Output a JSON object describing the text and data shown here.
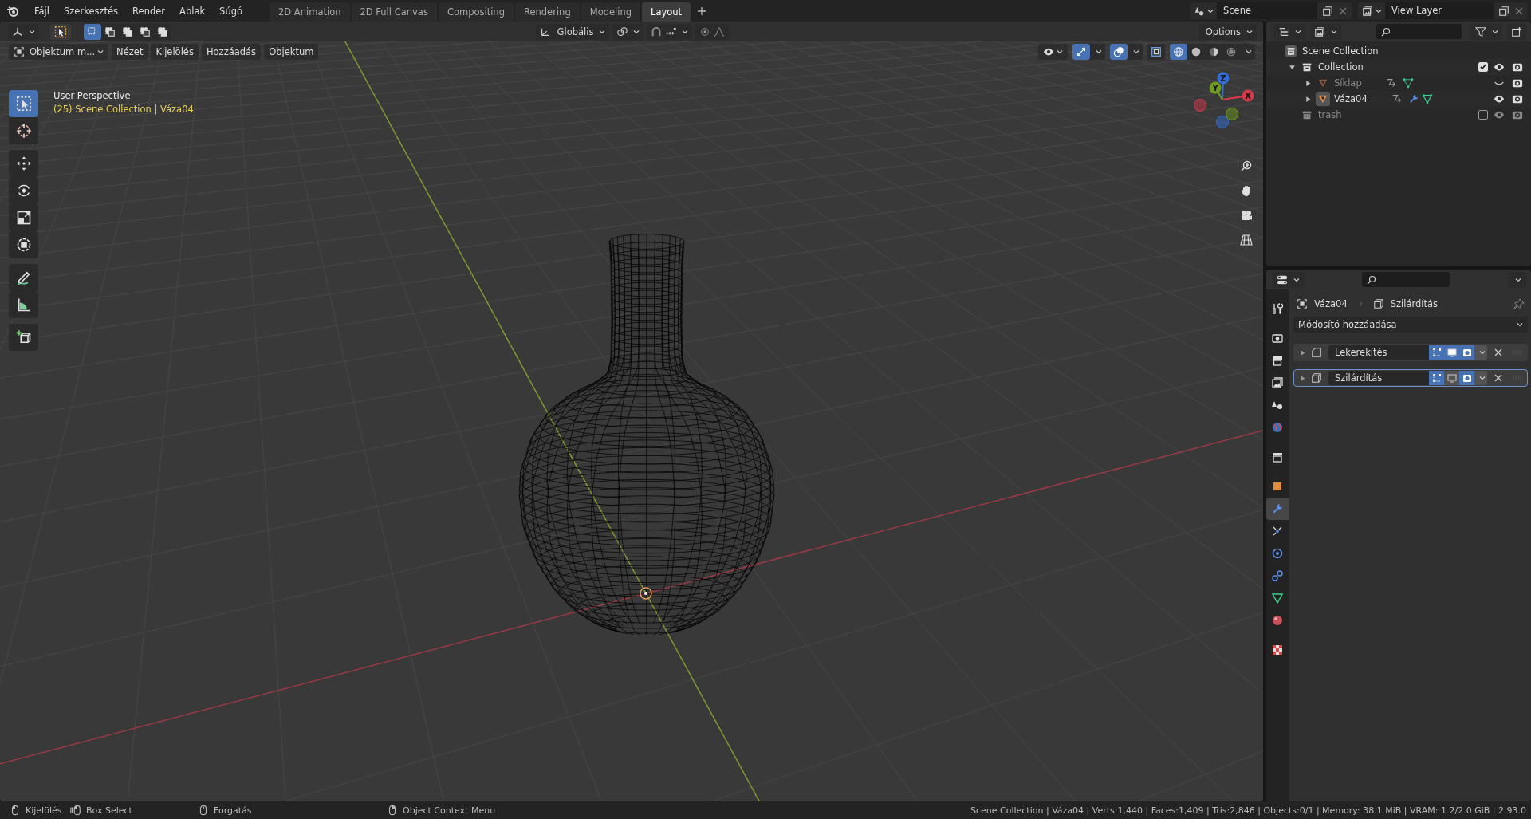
{
  "top_bar": {
    "menus": [
      "Fájl",
      "Szerkesztés",
      "Render",
      "Ablak",
      "Súgó"
    ],
    "workspaces": [
      {
        "label": "2D Animation",
        "selected": false
      },
      {
        "label": "2D Full Canvas",
        "selected": false
      },
      {
        "label": "Compositing",
        "selected": false
      },
      {
        "label": "Rendering",
        "selected": false
      },
      {
        "label": "Modeling",
        "selected": false
      },
      {
        "label": "Layout",
        "selected": true
      }
    ],
    "scene": "Scene",
    "view_layer": "View Layer"
  },
  "viewport": {
    "select_modes": [
      {
        "selected": true
      },
      {
        "selected": false
      },
      {
        "selected": false
      },
      {
        "selected": false
      },
      {
        "selected": false
      }
    ],
    "orientation": "Globális",
    "options": "Options",
    "mode": "Objektum m...",
    "menus": [
      "Nézet",
      "Kijelölés",
      "Hozzáadás",
      "Objektum"
    ],
    "shading": [
      {
        "kind": "wireframe",
        "selected": true
      },
      {
        "kind": "solid",
        "selected": false
      },
      {
        "kind": "material",
        "selected": false
      },
      {
        "kind": "rendered",
        "selected": false
      }
    ],
    "perspective": "User Perspective",
    "object_info": "(25) Scene Collection | Váza04",
    "tools": [
      {
        "kind": "select_box",
        "selected": true
      },
      {
        "kind": "cursor",
        "selected": false
      },
      {
        "kind": "move",
        "selected": false
      },
      {
        "kind": "rotate",
        "selected": false
      },
      {
        "kind": "scale",
        "selected": false
      },
      {
        "kind": "transform",
        "selected": false
      },
      {
        "kind": "annotate",
        "selected": false
      },
      {
        "kind": "measure",
        "selected": false
      },
      {
        "kind": "add_cube",
        "selected": false
      }
    ],
    "gizmo_axes": [
      {
        "label": "Z",
        "color": "#2f6fd6"
      },
      {
        "label": "Y",
        "color": "#6f9c1c"
      },
      {
        "label": "X",
        "color": "#d9384b"
      }
    ]
  },
  "outliner": {
    "tree": [
      {
        "name": "Scene Collection",
        "kind": "scene",
        "selected": false,
        "children": [
          {
            "name": "Collection",
            "kind": "collection",
            "selected": false,
            "expanded": true,
            "checked": true,
            "visible": true,
            "children": [
              {
                "name": "Síklap",
                "kind": "mesh",
                "selected": false,
                "expanded": false,
                "visible": false,
                "modifiers": false
              },
              {
                "name": "Váza04",
                "kind": "mesh",
                "selected": true,
                "expanded": false,
                "visible": true,
                "modifiers": true
              }
            ]
          },
          {
            "name": "trash",
            "kind": "collection",
            "selected": false,
            "checked": false,
            "visible": true
          }
        ]
      }
    ]
  },
  "properties": {
    "object": "Váza04",
    "modifier": "Szilárdítás",
    "add_modifier": "Módosító hozzáadása",
    "tabs": [
      {
        "kind": "tool",
        "selected": false
      },
      {
        "kind": "render",
        "selected": false
      },
      {
        "kind": "output",
        "selected": false
      },
      {
        "kind": "view_layer",
        "selected": false
      },
      {
        "kind": "scene",
        "selected": false
      },
      {
        "kind": "world",
        "selected": false
      },
      {
        "kind": "collection",
        "selected": false
      },
      {
        "kind": "object",
        "selected": false
      },
      {
        "kind": "modifiers",
        "selected": true
      },
      {
        "kind": "particles",
        "selected": false
      },
      {
        "kind": "physics",
        "selected": false
      },
      {
        "kind": "constraints",
        "selected": false
      },
      {
        "kind": "data",
        "selected": false
      },
      {
        "kind": "material",
        "selected": false
      },
      {
        "kind": "texture",
        "selected": false
      }
    ],
    "modifiers": [
      {
        "name": "Lekerekítés",
        "kind": "bevel",
        "expanded": false,
        "selected": false,
        "edit_mode": true,
        "viewport": true,
        "render": true
      },
      {
        "name": "Szilárdítás",
        "kind": "solidify",
        "expanded": false,
        "selected": true,
        "edit_mode": true,
        "viewport": false,
        "render": true
      }
    ]
  },
  "status_bar": {
    "hints": [
      {
        "kind": "mouse_left",
        "label": "Kijelölés"
      },
      {
        "kind": "mouse_drag",
        "label": "Box Select"
      },
      {
        "kind": "mouse_middle",
        "label": "Forgatás"
      },
      {
        "kind": "mouse_right",
        "label": "Object Context Menu"
      }
    ],
    "stats": "Scene Collection | Váza04 | Verts:1,440 | Faces:1,409 | Tris:2,846 | Objects:0/1 | Memory: 38.1 MiB | VRAM: 1.2/2.0 GiB | 2.93.0"
  }
}
